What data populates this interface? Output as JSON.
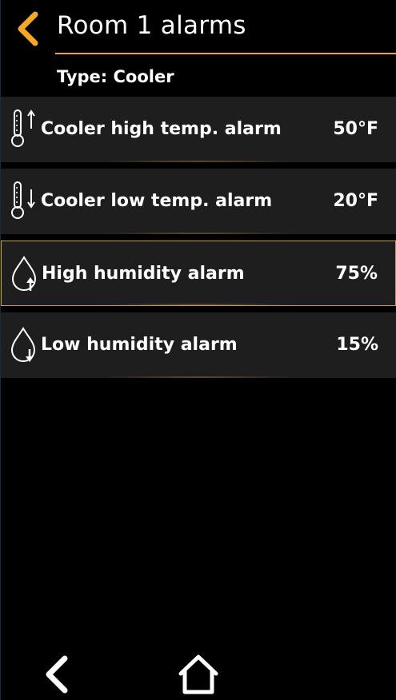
{
  "header": {
    "title": "Room 1 alarms",
    "back_icon": "chevron-left-icon",
    "accent_color": "#f5a623"
  },
  "type_label": "Type: Cooler",
  "alarms": [
    {
      "label": "Cooler high temp. alarm",
      "value": "50°F",
      "icon": "thermometer-up-icon",
      "selected": false
    },
    {
      "label": "Cooler low temp. alarm",
      "value": "20°F",
      "icon": "thermometer-down-icon",
      "selected": false
    },
    {
      "label": "High humidity alarm",
      "value": "75%",
      "icon": "droplet-up-icon",
      "selected": true
    },
    {
      "label": "Low humidity alarm",
      "value": "15%",
      "icon": "droplet-down-icon",
      "selected": false
    }
  ],
  "bottom_nav": {
    "back_icon": "chevron-left-icon",
    "home_icon": "home-icon"
  },
  "colors": {
    "background": "#000000",
    "row_background": "#1e1e1e",
    "selected_border": "#c9a227",
    "text": "#ffffff"
  }
}
